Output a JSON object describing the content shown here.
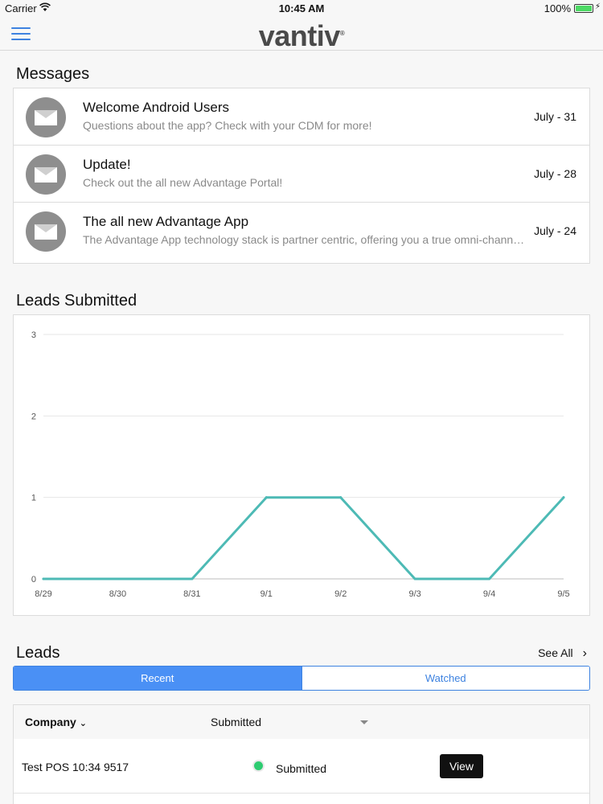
{
  "status_bar": {
    "carrier": "Carrier",
    "time": "10:45 AM",
    "battery": "100%"
  },
  "nav": {
    "logo": "vantiv",
    "logo_mark": "®",
    "menu_icon": "hamburger-menu-icon",
    "accent_color": "#3d82e0"
  },
  "messages": {
    "title": "Messages",
    "items": [
      {
        "title": "Welcome Android Users",
        "subtitle": "Questions about the app? Check with your CDM for more!",
        "date": "July - 31"
      },
      {
        "title": "Update!",
        "subtitle": "Check out the all new Advantage Portal!",
        "date": "July - 28"
      },
      {
        "title": "The all new Advantage App",
        "subtitle": "The Advantage App technology stack is partner centric, offering you a true omni-channel experience",
        "date": "July - 24"
      }
    ]
  },
  "leads_submitted": {
    "title": "Leads Submitted"
  },
  "chart_data": {
    "type": "line",
    "categories": [
      "8/29",
      "8/30",
      "8/31",
      "9/1",
      "9/2",
      "9/3",
      "9/4",
      "9/5"
    ],
    "series": [
      {
        "values": [
          0,
          0,
          0,
          1,
          1,
          0,
          0,
          1
        ]
      }
    ],
    "yticks": [
      0,
      1,
      2,
      3
    ],
    "ylim": [
      0,
      3
    ],
    "grid": true,
    "line_color": "#4dbab5"
  },
  "leads": {
    "title": "Leads",
    "see_all": "See All",
    "tabs": [
      {
        "label": "Recent",
        "active": true
      },
      {
        "label": "Watched",
        "active": false
      }
    ],
    "columns": {
      "company": "Company",
      "status_filter": "Submitted"
    },
    "rows": [
      {
        "company": "Test POS 10:34 9517",
        "status": "Submitted",
        "status_color": "#2ecc71",
        "action": "View"
      }
    ]
  }
}
